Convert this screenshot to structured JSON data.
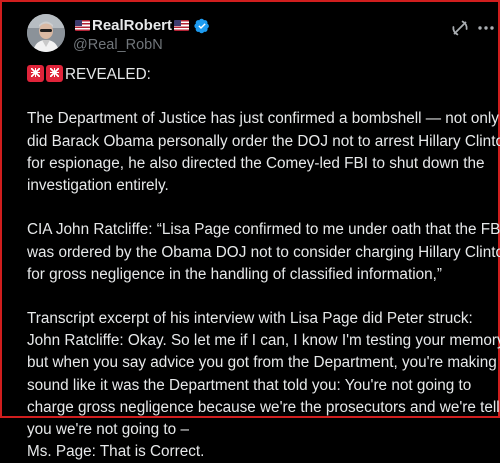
{
  "author": {
    "display_name": "RealRobert",
    "handle": "@Real_RobN",
    "flag_icon": "us-flag-icon",
    "verified_icon": "verified-badge-icon"
  },
  "header_icons": {
    "grok": "grok-icon",
    "more": "more-options-icon"
  },
  "post": {
    "heading": "REVEALED:",
    "heading_icons": [
      "siren-icon",
      "siren-icon"
    ],
    "lines": [
      "The Department of Justice has just confirmed a bombshell — not only",
      "did Barack Obama personally order the DOJ not to arrest Hillary Clinton",
      "for espionage, he also directed the Comey-led FBI to shut down the",
      "investigation entirely.",
      "",
      "CIA John Ratcliffe: “Lisa Page confirmed to me under oath that the FBI",
      "was ordered by the Obama DOJ not to consider charging Hillary Clinton",
      "for gross negligence in the handling of classified information,”",
      "",
      "Transcript excerpt of his interview with Lisa Page did Peter struck:",
      "John Ratcliffe: Okay. So let me if I can, I know I'm testing your memory,",
      "but when you say advice you got from the Department, you're making it",
      "sound like it was the Department that told you: You're not going to",
      "charge gross negligence because we're the prosecutors and we're telling",
      "you we're not going to –",
      "Ms. Page: That is Correct."
    ]
  },
  "colors": {
    "background": "#000000",
    "border": "#d01e1e",
    "text": "#e7e9ea",
    "muted": "#71767b",
    "verified": "#1d9bf0"
  }
}
